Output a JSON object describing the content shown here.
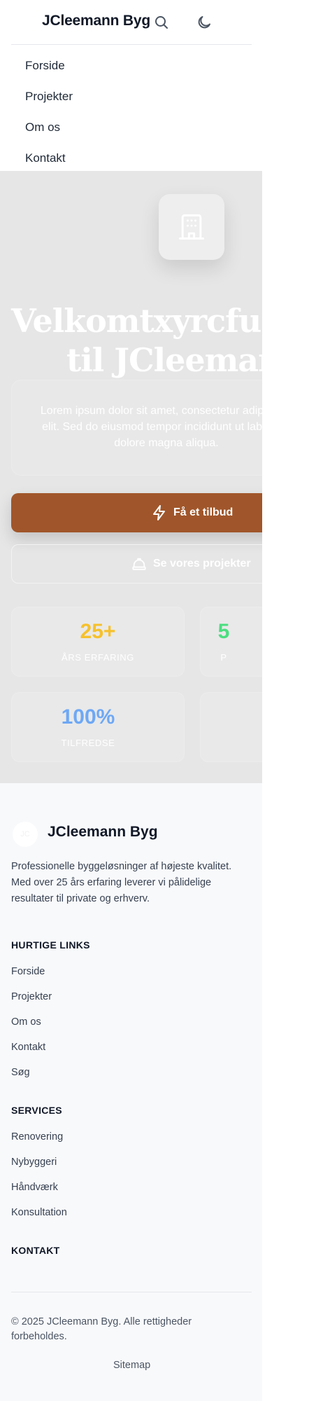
{
  "header": {
    "brand": "JCleemann Byg",
    "icons": [
      "search-icon",
      "moon-icon",
      "menu-icon"
    ]
  },
  "nav": {
    "items": [
      "Forside",
      "Projekter",
      "Om os",
      "Kontakt"
    ]
  },
  "hero": {
    "title_line1": "Velkomtxyrcfugvi",
    "title_line2": "til JCleemann",
    "lead": "Lorem ipsum dolor sit amet, consectetur adipiscing elit. Sed do eiusmod tempor incididunt ut labore et dolore magna aliqua.",
    "cta_primary": "Få et tilbud",
    "cta_secondary": "Se vores projekter",
    "stats": [
      {
        "value": "25+",
        "label": "ÅRS ERFARING",
        "color": "#f6c12c"
      },
      {
        "value": "5",
        "label": "P",
        "color": "#4ade80"
      },
      {
        "value": "100%",
        "label": "TILFREDSE",
        "color": "#6ea8f5"
      }
    ]
  },
  "footer": {
    "logo_text": "JC",
    "brand": "JCleemann Byg",
    "description": "Professionelle byggeløsninger af højeste kvalitet. Med over 25 års erfaring leverer vi pålidelige resultater til private og erhverv.",
    "quick_links_heading": "HURTIGE LINKS",
    "quick_links": [
      "Forside",
      "Projekter",
      "Om os",
      "Kontakt",
      "Søg"
    ],
    "services_heading": "SERVICES",
    "services": [
      "Renovering",
      "Nybyggeri",
      "Håndværk",
      "Konsultation"
    ],
    "contact_heading": "KONTAKT",
    "copyright": "© 2025 JCleemann Byg. Alle rettigheder forbeholdes.",
    "sitemap": "Sitemap"
  },
  "colors": {
    "accent": "#a0562a",
    "hero_bg": "#e6e6e6",
    "footer_bg": "#f8f9fb"
  }
}
